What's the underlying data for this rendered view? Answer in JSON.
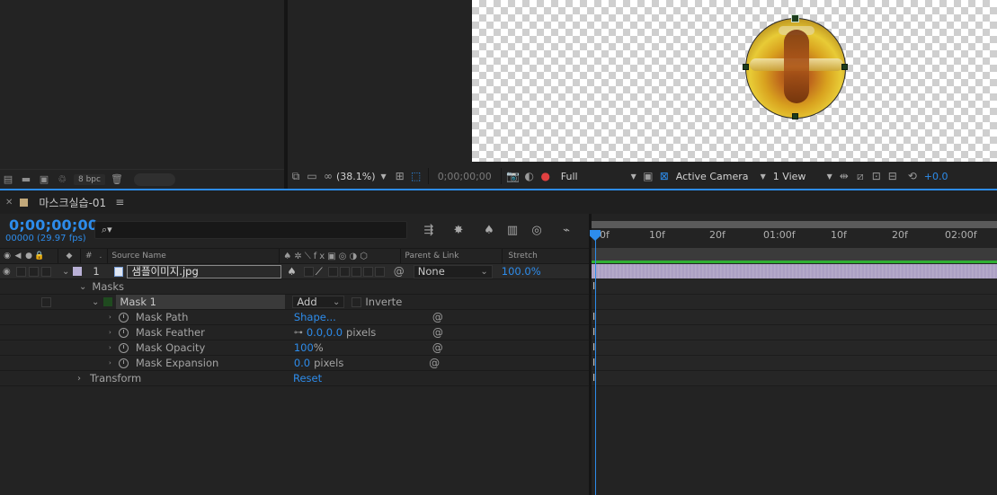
{
  "project_panel": {
    "bpc_label": "8 bpc"
  },
  "viewer_toolbar": {
    "zoom": "(38.1%)",
    "timecode": "0;00;00;00",
    "resolution": "Full",
    "camera": "Active Camera",
    "views": "1 View",
    "exposure": "+0.0"
  },
  "timeline": {
    "tab_title": "마스크실습-01",
    "timecode": "0;00;00;00",
    "fps": "00000 (29.97 fps)",
    "search_placeholder": "",
    "columns": {
      "number": "#",
      "source_name": "Source Name",
      "parent_link": "Parent & Link",
      "stretch": "Stretch"
    },
    "layer": {
      "number": "1",
      "name": "샘플이미지.jpg",
      "parent": "None",
      "stretch": "100.0%"
    },
    "masks_group": "Masks",
    "mask": {
      "name": "Mask 1",
      "mode": "Add",
      "inverted_label": "Inverte"
    },
    "properties": [
      {
        "label": "Mask Path",
        "value": "Shape...",
        "unit": ""
      },
      {
        "label": "Mask Feather",
        "value": "0.0,0.0",
        "unit": "pixels"
      },
      {
        "label": "Mask Opacity",
        "value": "100",
        "unit": "%"
      },
      {
        "label": "Mask Expansion",
        "value": "0.0",
        "unit": "pixels"
      }
    ],
    "transform": {
      "label": "Transform",
      "value": "Reset"
    },
    "ruler_ticks": [
      "00f",
      "10f",
      "20f",
      "01:00f",
      "10f",
      "20f",
      "02:00f"
    ]
  },
  "colors": {
    "accent": "#2d8ceb",
    "label_swatch": "#c1a87a",
    "layer_label": "#b9b0d6",
    "layer_bar": "#b4a9c8",
    "work_bar": "#2fb033"
  },
  "icons": [
    "interpret-footage-icon",
    "folder-icon",
    "composition-icon",
    "flowchart-icon",
    "trash-icon",
    "camera-icon",
    "color-channels-icon",
    "grid-icon",
    "roi-icon",
    "snapshot-icon",
    "fast-preview-icon",
    "timeline-icon",
    "flowchart-view-icon",
    "reset-exposure-icon",
    "search-icon",
    "comp-mini-flowchart-icon",
    "draft-3d-icon",
    "shy-icon",
    "frame-blending-icon",
    "motion-blur-icon",
    "graph-editor-icon",
    "stopwatch-icon",
    "pickwhip-icon",
    "chevron-down-icon",
    "chevron-right-icon",
    "eye-icon",
    "audio-icon",
    "solo-icon",
    "lock-icon",
    "label-icon"
  ]
}
